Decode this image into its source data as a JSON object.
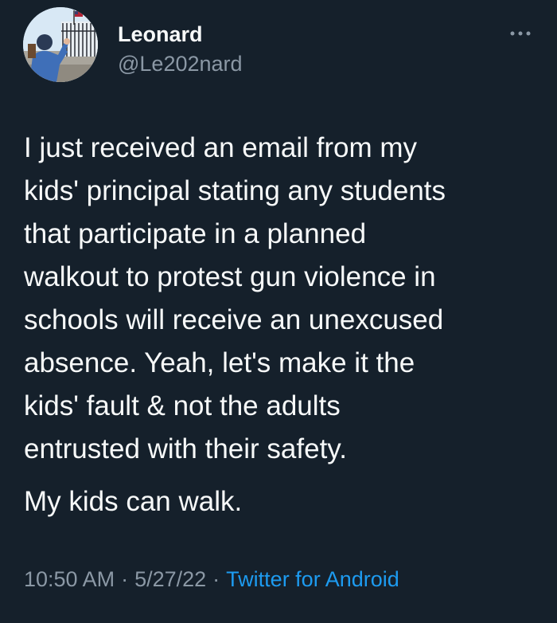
{
  "author": {
    "display_name": "Leonard",
    "handle": "@Le202nard",
    "avatar_icon": "profile-photo-icon"
  },
  "menu": {
    "icon": "more-options-icon"
  },
  "tweet": {
    "paragraph1_lines": [
      "I just received an email from my",
      "kids' principal stating any students",
      "that participate in a planned",
      "walkout to protest gun violence in",
      "schools will receive an unexcused",
      "absence. Yeah, let's make it the",
      "kids' fault & not the adults",
      "entrusted with their safety."
    ],
    "paragraph2": "My kids can walk."
  },
  "meta": {
    "time": "10:50 AM",
    "date": "5/27/22",
    "separator": "·",
    "source": "Twitter for Android"
  },
  "colors": {
    "background": "#15202b",
    "text": "#f7f9f9",
    "secondary_text": "#8b98a5",
    "link": "#1d9bf0"
  }
}
